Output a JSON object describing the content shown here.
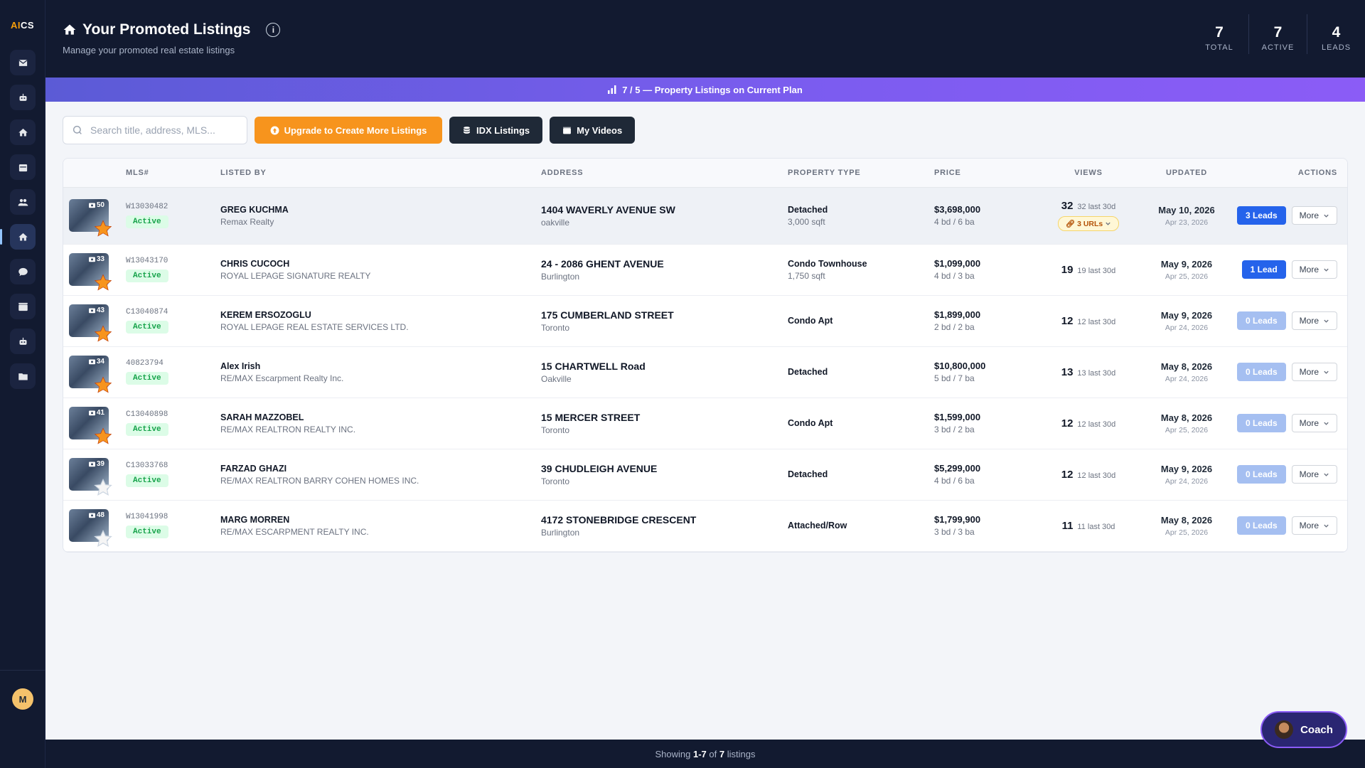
{
  "app": {
    "logo": "AICS"
  },
  "sidebar": {
    "items": [
      {
        "name": "sidebar-item-mail",
        "icon": "mail-icon"
      },
      {
        "name": "sidebar-item-bot",
        "icon": "robot-icon"
      },
      {
        "name": "sidebar-item-home",
        "icon": "home-icon"
      },
      {
        "name": "sidebar-item-calendar",
        "icon": "calendar-icon"
      },
      {
        "name": "sidebar-item-contacts",
        "icon": "users-icon"
      },
      {
        "name": "sidebar-item-listings",
        "icon": "home-icon"
      },
      {
        "name": "sidebar-item-chat",
        "icon": "chat-icon"
      },
      {
        "name": "sidebar-item-video",
        "icon": "video-icon"
      },
      {
        "name": "sidebar-item-assistant",
        "icon": "robot-icon"
      },
      {
        "name": "sidebar-item-folder",
        "icon": "folder-icon"
      }
    ],
    "avatar_initial": "M"
  },
  "header": {
    "title": "Your Promoted Listings",
    "info": "i",
    "subtitle": "Manage your promoted real estate listings",
    "stats": [
      {
        "value": "7",
        "label": "TOTAL"
      },
      {
        "value": "7",
        "label": "ACTIVE"
      },
      {
        "value": "4",
        "label": "LEADS"
      }
    ]
  },
  "plan_banner": {
    "text": "7 / 5 — Property Listings on Current Plan"
  },
  "toolbar": {
    "search_placeholder": "Search title, address, MLS...",
    "upgrade_label": "Upgrade to Create More Listings",
    "idx_label": "IDX Listings",
    "videos_label": "My Videos"
  },
  "table": {
    "headers": [
      "",
      "MLS#",
      "LISTED BY",
      "ADDRESS",
      "PROPERTY TYPE",
      "PRICE",
      "VIEWS",
      "UPDATED",
      "ACTIONS"
    ],
    "rows": [
      {
        "photos": "50",
        "starred": true,
        "mls": "W13030482",
        "status": "Active",
        "agent": "GREG KUCHMA",
        "brokerage": "Remax Realty",
        "address": "1404 WAVERLY AVENUE SW",
        "city": "oakville",
        "type": "Detached",
        "sqft": "3,000 sqft",
        "price": "$3,698,000",
        "beds": "4 bd / 6 ba",
        "views": "32",
        "last30": "32 last 30d",
        "urls": "3 URLs",
        "updated": "May 10, 2026",
        "created": "Apr 23, 2026",
        "leads": "3 Leads",
        "leads_count": 3,
        "more": "More"
      },
      {
        "photos": "33",
        "starred": true,
        "mls": "W13043170",
        "status": "Active",
        "agent": "CHRIS CUCOCH",
        "brokerage": "ROYAL LEPAGE SIGNATURE REALTY",
        "address": "24 - 2086 GHENT AVENUE",
        "city": "Burlington",
        "type": "Condo Townhouse",
        "sqft": "1,750 sqft",
        "price": "$1,099,000",
        "beds": "4 bd / 3 ba",
        "views": "19",
        "last30": "19 last 30d",
        "urls": "",
        "updated": "May 9, 2026",
        "created": "Apr 25, 2026",
        "leads": "1 Lead",
        "leads_count": 1,
        "more": "More"
      },
      {
        "photos": "43",
        "starred": true,
        "mls": "C13040874",
        "status": "Active",
        "agent": "KEREM ERSOZOGLU",
        "brokerage": "ROYAL LEPAGE REAL ESTATE SERVICES LTD.",
        "address": "175 CUMBERLAND STREET",
        "city": "Toronto",
        "type": "Condo Apt",
        "sqft": "",
        "price": "$1,899,000",
        "beds": "2 bd / 2 ba",
        "views": "12",
        "last30": "12 last 30d",
        "urls": "",
        "updated": "May 9, 2026",
        "created": "Apr 24, 2026",
        "leads": "0 Leads",
        "leads_count": 0,
        "more": "More"
      },
      {
        "photos": "34",
        "starred": true,
        "mls": "40823794",
        "status": "Active",
        "agent": "Alex Irish",
        "brokerage": "RE/MAX Escarpment Realty Inc.",
        "address": "15 CHARTWELL Road",
        "city": "Oakville",
        "type": "Detached",
        "sqft": "",
        "price": "$10,800,000",
        "beds": "5 bd / 7 ba",
        "views": "13",
        "last30": "13 last 30d",
        "urls": "",
        "updated": "May 8, 2026",
        "created": "Apr 24, 2026",
        "leads": "0 Leads",
        "leads_count": 0,
        "more": "More"
      },
      {
        "photos": "41",
        "starred": true,
        "mls": "C13040898",
        "status": "Active",
        "agent": "SARAH MAZZOBEL",
        "brokerage": "RE/MAX REALTRON REALTY INC.",
        "address": "15 MERCER STREET",
        "city": "Toronto",
        "type": "Condo Apt",
        "sqft": "",
        "price": "$1,599,000",
        "beds": "3 bd / 2 ba",
        "views": "12",
        "last30": "12 last 30d",
        "urls": "",
        "updated": "May 8, 2026",
        "created": "Apr 25, 2026",
        "leads": "0 Leads",
        "leads_count": 0,
        "more": "More"
      },
      {
        "photos": "39",
        "starred": false,
        "mls": "C13033768",
        "status": "Active",
        "agent": "FARZAD GHAZI",
        "brokerage": "RE/MAX REALTRON BARRY COHEN HOMES INC.",
        "address": "39 CHUDLEIGH AVENUE",
        "city": "Toronto",
        "type": "Detached",
        "sqft": "",
        "price": "$5,299,000",
        "beds": "4 bd / 6 ba",
        "views": "12",
        "last30": "12 last 30d",
        "urls": "",
        "updated": "May 9, 2026",
        "created": "Apr 24, 2026",
        "leads": "0 Leads",
        "leads_count": 0,
        "more": "More"
      },
      {
        "photos": "48",
        "starred": false,
        "mls": "W13041998",
        "status": "Active",
        "agent": "MARG MORREN",
        "brokerage": "RE/MAX ESCARPMENT REALTY INC.",
        "address": "4172 STONEBRIDGE CRESCENT",
        "city": "Burlington",
        "type": "Attached/Row",
        "sqft": "",
        "price": "$1,799,900",
        "beds": "3 bd / 3 ba",
        "views": "11",
        "last30": "11 last 30d",
        "urls": "",
        "updated": "May 8, 2026",
        "created": "Apr 25, 2026",
        "leads": "0 Leads",
        "leads_count": 0,
        "more": "More"
      }
    ]
  },
  "footer": {
    "prefix": "Showing ",
    "range": "1-7",
    "middle": " of ",
    "total": "7",
    "suffix": " listings"
  },
  "coach": {
    "label": "Coach"
  },
  "colors": {
    "accent": "#2563eb",
    "upgrade": "#f7941d",
    "navy": "#121a30",
    "banner": "#7c5cf0"
  }
}
